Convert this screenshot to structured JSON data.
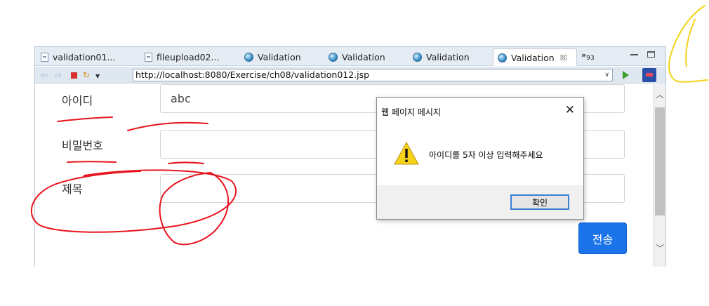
{
  "tabs": [
    {
      "label": "validation01...",
      "icon": "file-icon"
    },
    {
      "label": "fileupload02...",
      "icon": "file-icon"
    },
    {
      "label": "Validation",
      "icon": "globe-icon"
    },
    {
      "label": "Validation",
      "icon": "globe-icon"
    },
    {
      "label": "Validation",
      "icon": "globe-icon"
    },
    {
      "label": "Validation",
      "icon": "globe-icon",
      "active": true,
      "close": "☒"
    }
  ],
  "overflow": {
    "chevrons": "»",
    "count": "93"
  },
  "toolbar": {
    "url": "http://localhost:8080/Exercise/ch08/validation012.jsp"
  },
  "form": {
    "id_label": "아이디",
    "id_value": "abc",
    "password_label": "비밀번호",
    "password_value": "",
    "subject_label": "제목",
    "subject_value": "",
    "submit_label": "전송"
  },
  "dialog": {
    "title": "웹 페이지 메시지",
    "close": "✕",
    "message": "아이디를 5자 이상 입력해주세요",
    "ok_label": "확인"
  },
  "colors": {
    "submit_bg": "#1a73e8",
    "annotation_red": "#e8141e",
    "annotation_yellow": "#f3d317"
  }
}
